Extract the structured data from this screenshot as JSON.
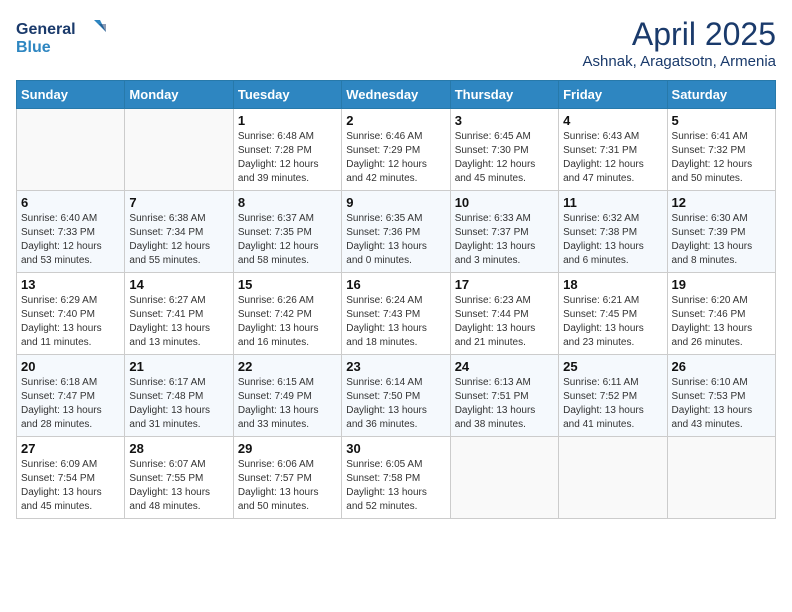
{
  "header": {
    "logo_line1": "General",
    "logo_line2": "Blue",
    "title": "April 2025",
    "subtitle": "Ashnak, Aragatsotn, Armenia"
  },
  "weekdays": [
    "Sunday",
    "Monday",
    "Tuesday",
    "Wednesday",
    "Thursday",
    "Friday",
    "Saturday"
  ],
  "weeks": [
    [
      {
        "day": "",
        "info": ""
      },
      {
        "day": "",
        "info": ""
      },
      {
        "day": "1",
        "info": "Sunrise: 6:48 AM\nSunset: 7:28 PM\nDaylight: 12 hours and 39 minutes."
      },
      {
        "day": "2",
        "info": "Sunrise: 6:46 AM\nSunset: 7:29 PM\nDaylight: 12 hours and 42 minutes."
      },
      {
        "day": "3",
        "info": "Sunrise: 6:45 AM\nSunset: 7:30 PM\nDaylight: 12 hours and 45 minutes."
      },
      {
        "day": "4",
        "info": "Sunrise: 6:43 AM\nSunset: 7:31 PM\nDaylight: 12 hours and 47 minutes."
      },
      {
        "day": "5",
        "info": "Sunrise: 6:41 AM\nSunset: 7:32 PM\nDaylight: 12 hours and 50 minutes."
      }
    ],
    [
      {
        "day": "6",
        "info": "Sunrise: 6:40 AM\nSunset: 7:33 PM\nDaylight: 12 hours and 53 minutes."
      },
      {
        "day": "7",
        "info": "Sunrise: 6:38 AM\nSunset: 7:34 PM\nDaylight: 12 hours and 55 minutes."
      },
      {
        "day": "8",
        "info": "Sunrise: 6:37 AM\nSunset: 7:35 PM\nDaylight: 12 hours and 58 minutes."
      },
      {
        "day": "9",
        "info": "Sunrise: 6:35 AM\nSunset: 7:36 PM\nDaylight: 13 hours and 0 minutes."
      },
      {
        "day": "10",
        "info": "Sunrise: 6:33 AM\nSunset: 7:37 PM\nDaylight: 13 hours and 3 minutes."
      },
      {
        "day": "11",
        "info": "Sunrise: 6:32 AM\nSunset: 7:38 PM\nDaylight: 13 hours and 6 minutes."
      },
      {
        "day": "12",
        "info": "Sunrise: 6:30 AM\nSunset: 7:39 PM\nDaylight: 13 hours and 8 minutes."
      }
    ],
    [
      {
        "day": "13",
        "info": "Sunrise: 6:29 AM\nSunset: 7:40 PM\nDaylight: 13 hours and 11 minutes."
      },
      {
        "day": "14",
        "info": "Sunrise: 6:27 AM\nSunset: 7:41 PM\nDaylight: 13 hours and 13 minutes."
      },
      {
        "day": "15",
        "info": "Sunrise: 6:26 AM\nSunset: 7:42 PM\nDaylight: 13 hours and 16 minutes."
      },
      {
        "day": "16",
        "info": "Sunrise: 6:24 AM\nSunset: 7:43 PM\nDaylight: 13 hours and 18 minutes."
      },
      {
        "day": "17",
        "info": "Sunrise: 6:23 AM\nSunset: 7:44 PM\nDaylight: 13 hours and 21 minutes."
      },
      {
        "day": "18",
        "info": "Sunrise: 6:21 AM\nSunset: 7:45 PM\nDaylight: 13 hours and 23 minutes."
      },
      {
        "day": "19",
        "info": "Sunrise: 6:20 AM\nSunset: 7:46 PM\nDaylight: 13 hours and 26 minutes."
      }
    ],
    [
      {
        "day": "20",
        "info": "Sunrise: 6:18 AM\nSunset: 7:47 PM\nDaylight: 13 hours and 28 minutes."
      },
      {
        "day": "21",
        "info": "Sunrise: 6:17 AM\nSunset: 7:48 PM\nDaylight: 13 hours and 31 minutes."
      },
      {
        "day": "22",
        "info": "Sunrise: 6:15 AM\nSunset: 7:49 PM\nDaylight: 13 hours and 33 minutes."
      },
      {
        "day": "23",
        "info": "Sunrise: 6:14 AM\nSunset: 7:50 PM\nDaylight: 13 hours and 36 minutes."
      },
      {
        "day": "24",
        "info": "Sunrise: 6:13 AM\nSunset: 7:51 PM\nDaylight: 13 hours and 38 minutes."
      },
      {
        "day": "25",
        "info": "Sunrise: 6:11 AM\nSunset: 7:52 PM\nDaylight: 13 hours and 41 minutes."
      },
      {
        "day": "26",
        "info": "Sunrise: 6:10 AM\nSunset: 7:53 PM\nDaylight: 13 hours and 43 minutes."
      }
    ],
    [
      {
        "day": "27",
        "info": "Sunrise: 6:09 AM\nSunset: 7:54 PM\nDaylight: 13 hours and 45 minutes."
      },
      {
        "day": "28",
        "info": "Sunrise: 6:07 AM\nSunset: 7:55 PM\nDaylight: 13 hours and 48 minutes."
      },
      {
        "day": "29",
        "info": "Sunrise: 6:06 AM\nSunset: 7:57 PM\nDaylight: 13 hours and 50 minutes."
      },
      {
        "day": "30",
        "info": "Sunrise: 6:05 AM\nSunset: 7:58 PM\nDaylight: 13 hours and 52 minutes."
      },
      {
        "day": "",
        "info": ""
      },
      {
        "day": "",
        "info": ""
      },
      {
        "day": "",
        "info": ""
      }
    ]
  ]
}
